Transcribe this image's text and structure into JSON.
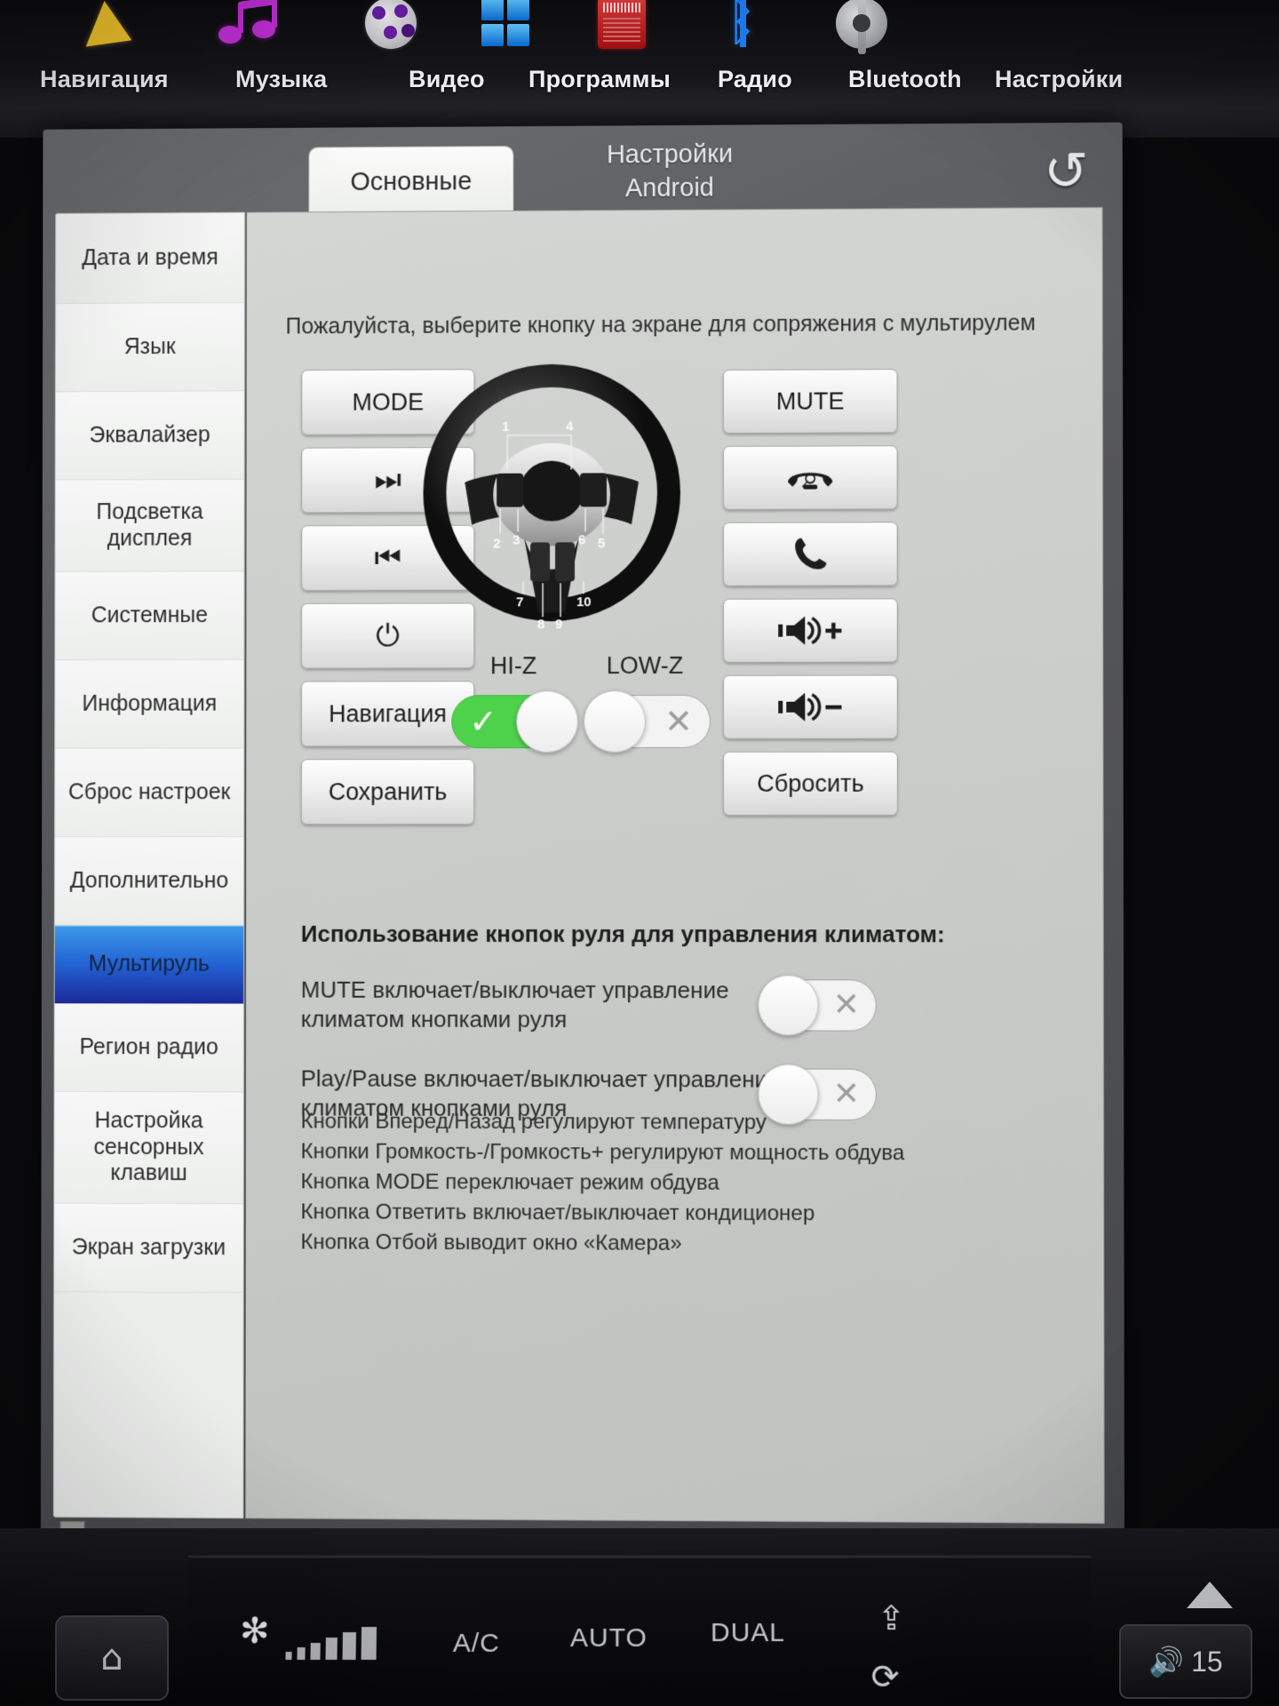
{
  "topbar": {
    "items": [
      {
        "label": "Навигация",
        "icon": "navigation-arrow-icon"
      },
      {
        "label": "Музыка",
        "icon": "music-note-icon"
      },
      {
        "label": "Видео",
        "icon": "film-reel-icon"
      },
      {
        "label": "Программы",
        "icon": "apps-grid-icon"
      },
      {
        "label": "Радио",
        "icon": "radio-icon"
      },
      {
        "label": "Bluetooth",
        "icon": "bluetooth-icon"
      },
      {
        "label": "Настройки",
        "icon": "gear-icon"
      }
    ]
  },
  "tabs": {
    "active": "Основные",
    "inactive_line1": "Настройки",
    "inactive_line2": "Android",
    "back_icon": "back-arrow-icon"
  },
  "sidebar": {
    "items": [
      {
        "label": "Дата и время",
        "selected": false
      },
      {
        "label": "Язык",
        "selected": false
      },
      {
        "label": "Эквалайзер",
        "selected": false
      },
      {
        "label": "Подсветка дисплея",
        "selected": false
      },
      {
        "label": "Системные",
        "selected": false
      },
      {
        "label": "Информация",
        "selected": false
      },
      {
        "label": "Сброс настроек",
        "selected": false
      },
      {
        "label": "Дополнительно",
        "selected": false
      },
      {
        "label": "Мультируль",
        "selected": true
      },
      {
        "label": "Регион радио",
        "selected": false
      },
      {
        "label": "Настройка сенсорных клавиш",
        "selected": false
      },
      {
        "label": "Экран загрузки",
        "selected": false
      }
    ]
  },
  "main": {
    "hint": "Пожалуйста, выберите кнопку на экране для сопряжения с мультирулем",
    "left_buttons": [
      {
        "label": "MODE",
        "icon": ""
      },
      {
        "label": "",
        "icon": "next-track-icon"
      },
      {
        "label": "",
        "icon": "prev-track-icon"
      },
      {
        "label": "",
        "icon": "power-icon"
      },
      {
        "label": "Навигация",
        "icon": ""
      },
      {
        "label": "Сохранить",
        "icon": ""
      }
    ],
    "right_buttons": [
      {
        "label": "MUTE",
        "icon": ""
      },
      {
        "label": "",
        "icon": "hang-up-icon"
      },
      {
        "label": "",
        "icon": "call-icon"
      },
      {
        "label": "",
        "icon": "volume-up-icon"
      },
      {
        "label": "",
        "icon": "volume-down-icon"
      },
      {
        "label": "Сбросить",
        "icon": ""
      }
    ],
    "wheel": {
      "alt": "steering-wheel-diagram",
      "callouts": [
        "1",
        "4",
        "2",
        "3",
        "6",
        "5",
        "7",
        "10",
        "8",
        "9"
      ]
    },
    "impedance": [
      {
        "label": "HI-Z",
        "state": "on",
        "mark": "✓"
      },
      {
        "label": "LOW-Z",
        "state": "off",
        "mark": "✕"
      }
    ],
    "climate": {
      "title": "Использование кнопок руля для управления климатом:",
      "rows": [
        {
          "line1": "MUTE включает/выключает управление",
          "line2": "климатом кнопками руля",
          "state": "off",
          "mark": "✕"
        },
        {
          "line1": "Play/Pause включает/выключает управление",
          "line2": "климатом кнопками руля",
          "state": "off",
          "mark": "✕"
        }
      ],
      "notes": [
        "Кнопки Вперед/Назад регулируют температуру",
        "Кнопки Громкость-/Громкость+ регулируют мощность обдува",
        "Кнопка MODE переключает режим обдува",
        "Кнопка Ответить включает/выключает кондиционер",
        "Кнопка Отбой выводит окно «Камера»"
      ]
    }
  },
  "hardware": {
    "fan_icon": "fan-icon",
    "labels": [
      "A/C",
      "AUTO",
      "DUAL"
    ],
    "defrost_icon": "defrost-icon",
    "recirculate_icon": "recirculate-icon",
    "home_icon": "home-icon",
    "up_icon": "up-arrow-icon",
    "volume_icon": "speaker-icon",
    "volume_value": "15"
  },
  "colors": {
    "accent_blue": "#2365d6",
    "toggle_on_green": "#4ed24b",
    "panel_bg": "#c9cbc9"
  }
}
